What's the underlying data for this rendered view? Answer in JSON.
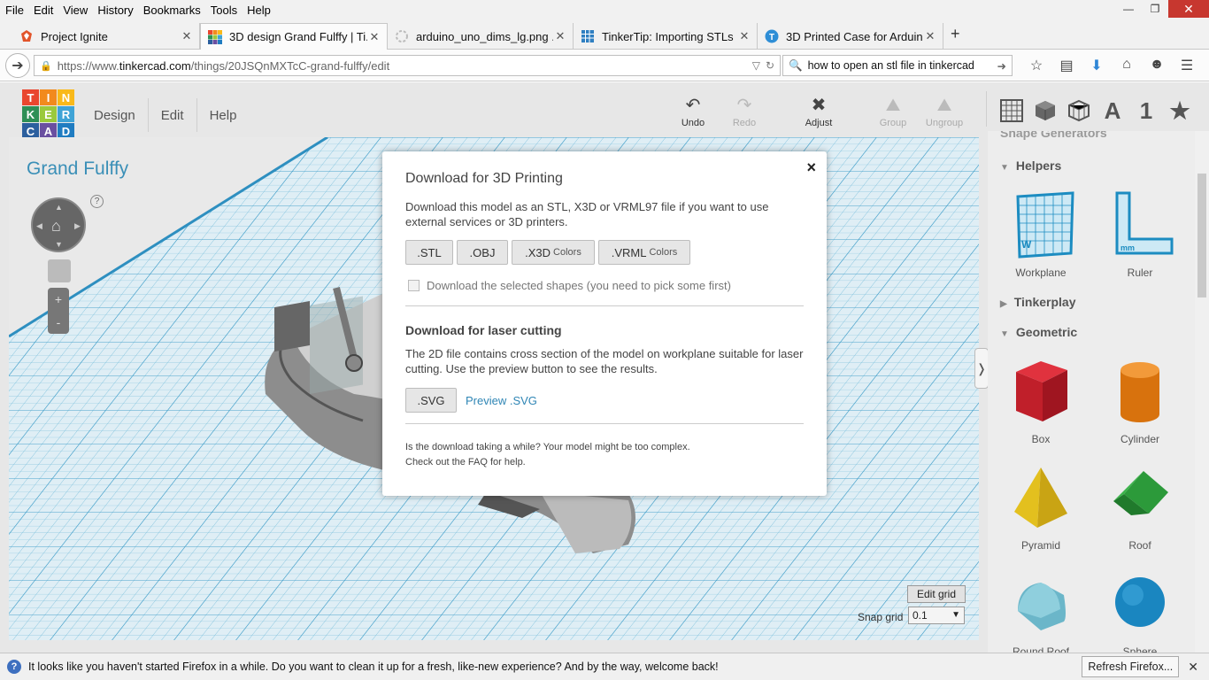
{
  "browser": {
    "menu": [
      "File",
      "Edit",
      "View",
      "History",
      "Bookmarks",
      "Tools",
      "Help"
    ],
    "window_controls": {
      "minimize": "—",
      "maximize": "❐",
      "close": "✕"
    },
    "tabs": [
      {
        "title": "Project Ignite",
        "icon": "project-ignite-icon",
        "active": false
      },
      {
        "title": "3D design Grand Fulffy | Ti...",
        "icon": "tinkercad-icon",
        "active": true
      },
      {
        "title": "arduino_uno_dims_lg.png ...",
        "icon": "image-loading-icon",
        "active": false
      },
      {
        "title": "TinkerTip: Importing STLs |...",
        "icon": "grid-icon",
        "active": false
      },
      {
        "title": "3D Printed Case for Arduin...",
        "icon": "site-t-icon",
        "active": false
      }
    ],
    "new_tab": "+",
    "url_prefix": "https://www.",
    "url_domain": "tinkercad.com",
    "url_path": "/things/20JSQnMXTcC-grand-fulffy/edit",
    "search_query": "how to open an stl file in tinkercad"
  },
  "app": {
    "logo": [
      "T",
      "I",
      "N",
      "K",
      "E",
      "R",
      "C",
      "A",
      "D"
    ],
    "logo_colors": [
      "#e9462e",
      "#f28a1d",
      "#f9b91a",
      "#2e8f56",
      "#9ac93c",
      "#3fa3d6",
      "#2b5f9e",
      "#6a4fa0",
      "#1f7cc1"
    ],
    "menu": [
      "Design",
      "Edit",
      "Help"
    ],
    "toolbar": {
      "undo": "Undo",
      "redo": "Redo",
      "adjust": "Adjust",
      "group": "Group",
      "ungroup": "Ungroup"
    },
    "right_tools": {
      "letter": "A",
      "number": "1"
    },
    "design_title": "Grand Fulffy",
    "help_q": "?",
    "zoom_in": "+",
    "zoom_out": "-",
    "edit_grid": "Edit grid",
    "snap_label": "Snap grid",
    "snap_value": "0.1",
    "collapse": "❭"
  },
  "panel": {
    "partial_header": "Shape Generators",
    "sections": {
      "helpers": "Helpers",
      "tinkerplay": "Tinkerplay",
      "geometric": "Geometric"
    },
    "helpers": [
      "Workplane",
      "Ruler"
    ],
    "workplane_letter": "W",
    "ruler_unit": "mm",
    "shapes": [
      "Box",
      "Cylinder",
      "Pyramid",
      "Roof",
      "Round Roof",
      "Sphere"
    ]
  },
  "modal": {
    "close": "×",
    "title": "Download for 3D Printing",
    "desc": "Download this model as an STL, X3D or VRML97 file if you want to use external services or 3D printers.",
    "buttons": {
      "stl": ".STL",
      "obj": ".OBJ",
      "x3d": ".X3D",
      "x3d_sub": "Colors",
      "vrml": ".VRML",
      "vrml_sub": "Colors"
    },
    "selected_label": "Download the selected shapes (you need to pick some first)",
    "laser_title": "Download for laser cutting",
    "laser_desc": "The 2D file contains cross section of the model on workplane suitable for laser cutting. Use the preview button to see the results.",
    "svg_button": ".SVG",
    "preview_link": "Preview .SVG",
    "footer_text": "Is the download taking a while? Your model might be too complex.",
    "faq_link": "Check out the FAQ for help."
  },
  "notification": {
    "message": "It looks like you haven't started Firefox in a while. Do you want to clean it up for a fresh, like-new experience? And by the way, welcome back!",
    "button": "Refresh Firefox...",
    "close": "✕"
  }
}
